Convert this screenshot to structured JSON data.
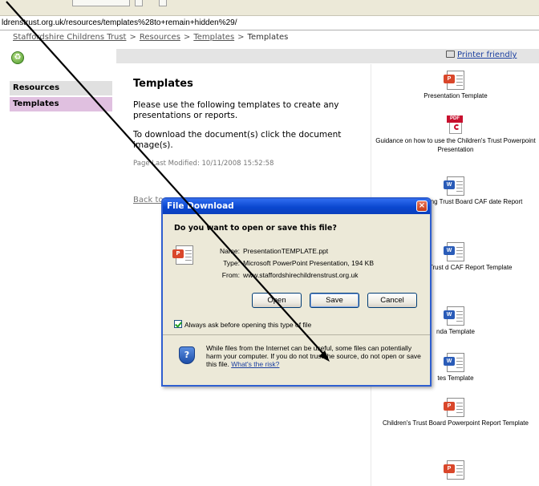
{
  "browser": {
    "address_url": "ldrenstrust.org.uk/resources/templates%28to+remain+hidden%29/"
  },
  "site": {
    "breadcrumb": [
      "Staffordshire Childrens Trust",
      "Resources",
      "Templates",
      "Templates"
    ],
    "breadcrumb_separator": ">",
    "printer_friendly": "Printer friendly",
    "nav": [
      "Resources",
      "Templates"
    ]
  },
  "page": {
    "title": "Templates",
    "para1": "Please use the following templates to create any presentations or reports.",
    "para2": "To download the document(s) click the document image(s).",
    "modified": "Page Last Modified: 10/11/2008 15:52:58",
    "back_link": "Back to"
  },
  "documents": [
    {
      "type": "ppt",
      "label": "Presentation Template"
    },
    {
      "type": "pdf",
      "label": "Guidance on how to use the Children's Trust Powerpoint Presentation"
    },
    {
      "type": "doc",
      "label": "es for completing Trust Board CAF date Report"
    },
    {
      "type": "doc",
      "label": "Children's Trust d CAF Report Template"
    },
    {
      "type": "doc",
      "label": "nda Template"
    },
    {
      "type": "doc",
      "label": "tes Template"
    },
    {
      "type": "ppt",
      "label": "Children's Trust Board Powerpoint Report Template"
    },
    {
      "type": "ppt",
      "label": ""
    }
  ],
  "dialog": {
    "title": "File Download",
    "close_glyph": "×",
    "question": "Do you want to open or save this file?",
    "name_label": "Name:",
    "name_value": "PresentationTEMPLATE.ppt",
    "type_label": "Type:",
    "type_value": "Microsoft PowerPoint Presentation, 194 KB",
    "from_label": "From:",
    "from_value": "www.staffordshirechildrenstrust.org.uk",
    "buttons": {
      "open": "Open",
      "save": "Save",
      "cancel": "Cancel"
    },
    "always_ask": "Always ask before opening this type of file",
    "always_ask_checked": true,
    "warning": "While files from the Internet can be useful, some files can potentially harm your computer. If you do not trust the source, do not open or save this file.",
    "risk_link": "What's the risk?"
  },
  "icons": {
    "logo": "recycle-logo-icon",
    "printer": "printer-icon",
    "shield": "security-shield-icon",
    "pointer": "arrow-pointer-icon"
  },
  "colors": {
    "titlebar": "#0a47cf",
    "close": "#c43a17",
    "nav_active": "#e0c0e0",
    "link": "#1b3fa0"
  }
}
